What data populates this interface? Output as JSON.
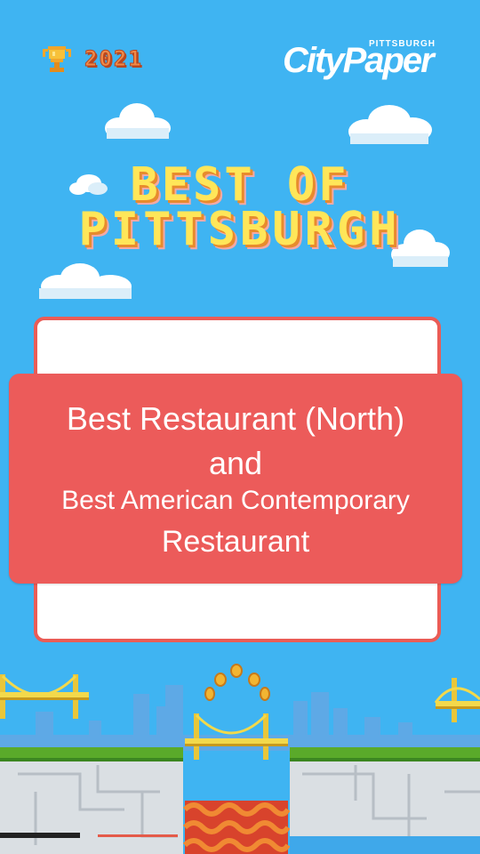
{
  "header": {
    "year": "2021",
    "logo_main": "CityPaper",
    "logo_small": "PITTSBURGH"
  },
  "title": {
    "line1": "BEST OF",
    "line2": "PITTSBURGH"
  },
  "award": {
    "line1": "Best Restaurant (North)",
    "line2": "and",
    "line3": "Best American Contemporary",
    "line4": "Restaurant"
  },
  "icons": [
    "trophy-icon",
    "cloud-icon",
    "bridge-icon",
    "coin-icon"
  ],
  "colors": {
    "sky": "#3fb4f2",
    "banner": "#ec5b5a",
    "title": "#ffe659",
    "grass": "#5aaa2a"
  }
}
